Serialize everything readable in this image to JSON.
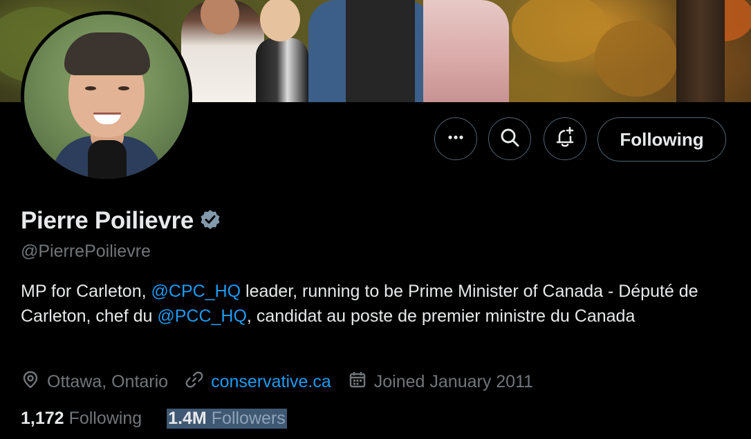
{
  "profile": {
    "name": "Pierre Poilievre",
    "handle": "@PierrePoilievre",
    "verified_badge_icon": "verified-badge-icon",
    "bio": {
      "p1": "MP for Carleton, ",
      "m1": "@CPC_HQ",
      "p2": " leader, running to be Prime Minister of Canada - Député de Carleton, chef du ",
      "m2": "@PCC_HQ",
      "p3": ", candidat au poste de premier ministre du Canada"
    },
    "location": "Ottawa, Ontario",
    "website": "conservative.ca",
    "joined": "Joined January 2011",
    "stats": {
      "following_count": "1,172",
      "following_label": "Following",
      "followers_count": "1.4M",
      "followers_label": "Followers"
    }
  },
  "actions": {
    "more_icon": "more-icon",
    "search_icon": "search-icon",
    "notify_icon": "bell-plus-icon",
    "follow_label": "Following"
  },
  "colors": {
    "background": "#000000",
    "text": "#e7e9ea",
    "secondary_text": "#71767b",
    "link": "#1d9bf0",
    "verified_badge": "#829aab",
    "selection_highlight": "#3f5873"
  }
}
